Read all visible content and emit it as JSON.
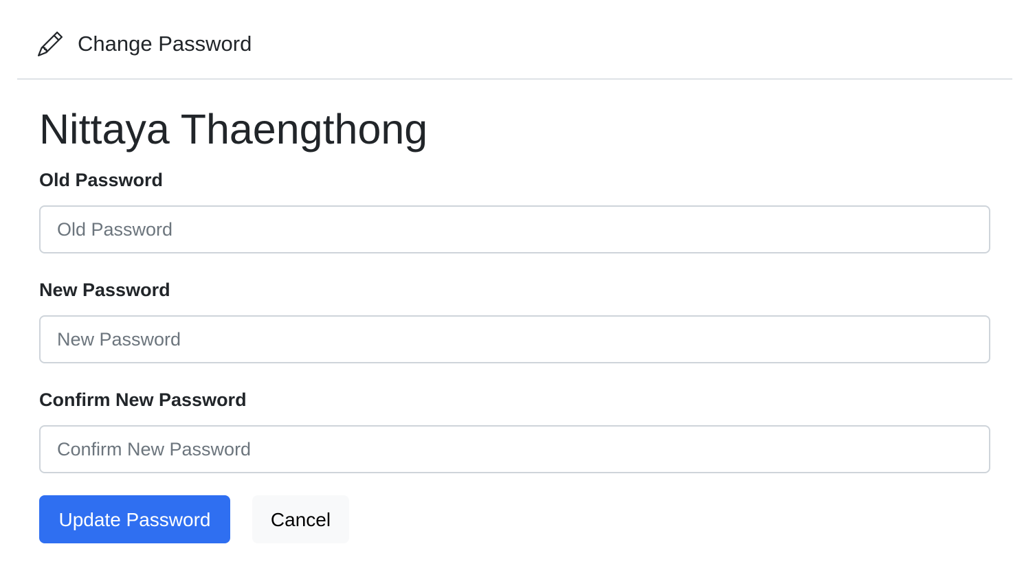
{
  "header": {
    "icon": "pencil-icon",
    "title": "Change Password"
  },
  "user": {
    "name": "Nittaya Thaengthong"
  },
  "form": {
    "old_password": {
      "label": "Old Password",
      "placeholder": "Old Password",
      "value": ""
    },
    "new_password": {
      "label": "New Password",
      "placeholder": "New Password",
      "value": ""
    },
    "confirm_password": {
      "label": "Confirm New Password",
      "placeholder": "Confirm New Password",
      "value": ""
    }
  },
  "actions": {
    "update_label": "Update Password",
    "cancel_label": "Cancel"
  },
  "colors": {
    "primary": "#2f6ff1",
    "secondary_bg": "#f8f9fa",
    "text": "#212529",
    "placeholder": "#6c757d",
    "border": "#ced4da"
  }
}
